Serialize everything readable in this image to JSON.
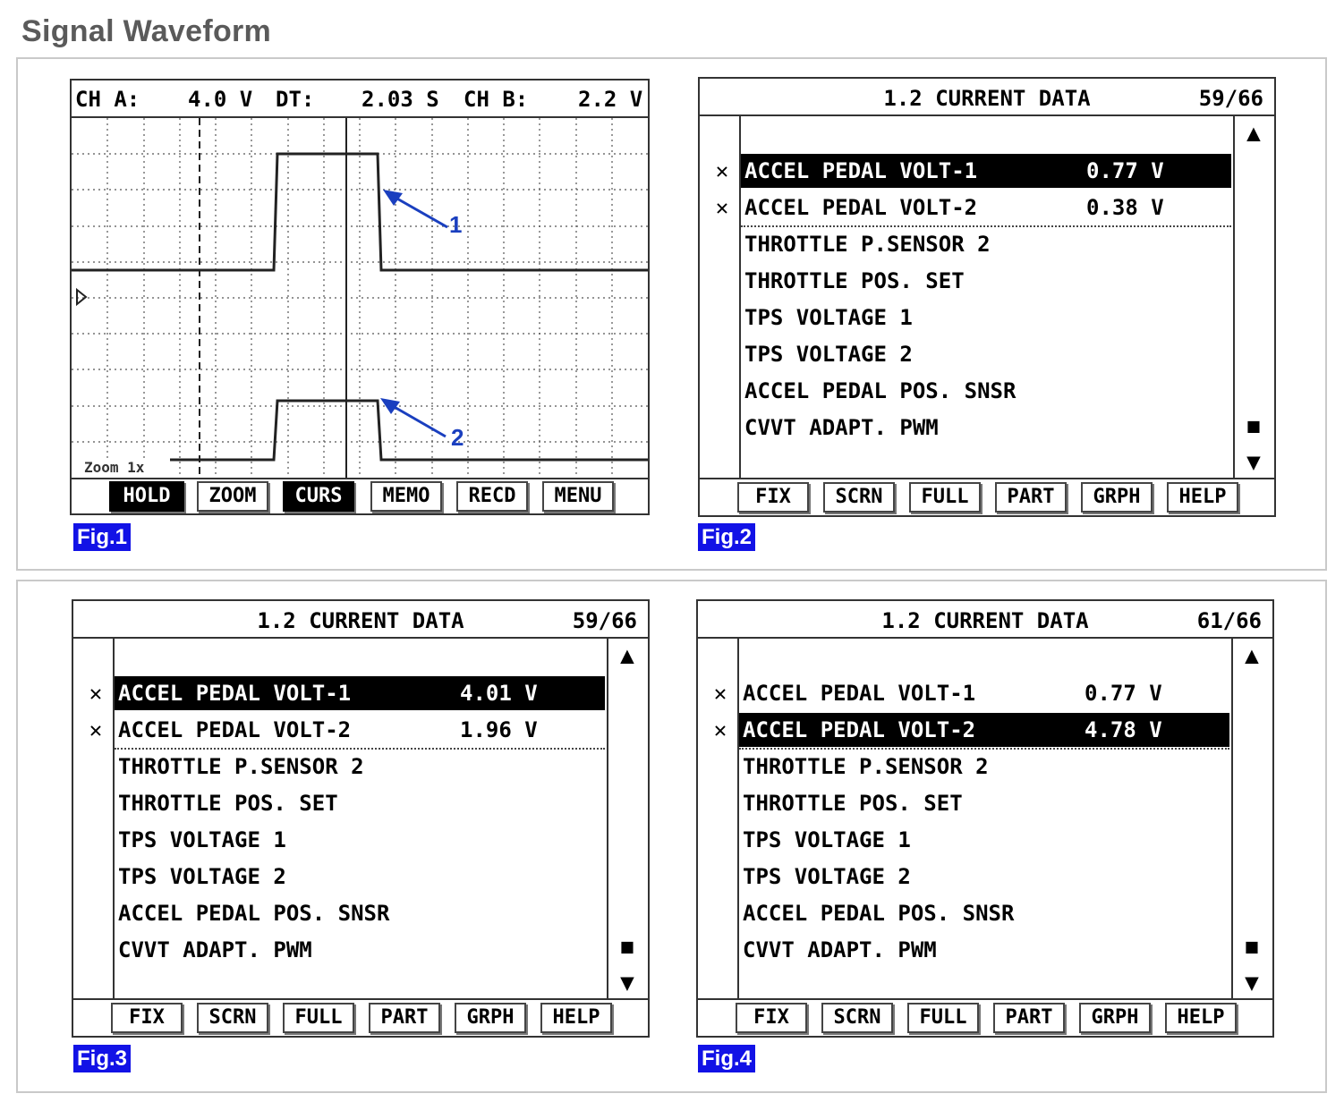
{
  "title": "Signal Waveform",
  "figures": {
    "fig1": "Fig.1",
    "fig2": "Fig.2",
    "fig3": "Fig.3",
    "fig4": "Fig.4"
  },
  "scope": {
    "ch_a_label": "CH A:",
    "ch_a_value": "4.0 V",
    "dt_label": "DT:",
    "dt_value": "2.03 S",
    "ch_b_label": "CH B:",
    "ch_b_value": "2.2 V",
    "zoom_label": "Zoom 1x",
    "callout_1": "1",
    "callout_2": "2",
    "softkeys": [
      "HOLD",
      "ZOOM",
      "CURS",
      "MEMO",
      "RECD",
      "MENU"
    ],
    "trace_color": "#222222",
    "arrow_color": "#1a3fbf"
  },
  "data_screens": [
    {
      "title": "1.2 CURRENT DATA",
      "page": "59/66",
      "selected_index": 0,
      "items": [
        {
          "name": "ACCEL PEDAL VOLT-1",
          "value": "0.77 V",
          "marked": true
        },
        {
          "name": "ACCEL PEDAL VOLT-2",
          "value": "0.38 V",
          "marked": true
        },
        {
          "name": "THROTTLE P.SENSOR 2",
          "value": "",
          "marked": false
        },
        {
          "name": "THROTTLE POS. SET",
          "value": "",
          "marked": false
        },
        {
          "name": "TPS VOLTAGE 1",
          "value": "",
          "marked": false
        },
        {
          "name": "TPS VOLTAGE 2",
          "value": "",
          "marked": false
        },
        {
          "name": "ACCEL PEDAL POS. SNSR",
          "value": "",
          "marked": false
        },
        {
          "name": "CVVT ADAPT. PWM",
          "value": "",
          "marked": false
        }
      ],
      "softkeys": [
        "FIX",
        "SCRN",
        "FULL",
        "PART",
        "GRPH",
        "HELP"
      ]
    },
    {
      "title": "1.2 CURRENT DATA",
      "page": "59/66",
      "selected_index": 0,
      "items": [
        {
          "name": "ACCEL PEDAL VOLT-1",
          "value": "4.01 V",
          "marked": true
        },
        {
          "name": "ACCEL PEDAL VOLT-2",
          "value": "1.96 V",
          "marked": true
        },
        {
          "name": "THROTTLE P.SENSOR 2",
          "value": "",
          "marked": false
        },
        {
          "name": "THROTTLE POS. SET",
          "value": "",
          "marked": false
        },
        {
          "name": "TPS VOLTAGE 1",
          "value": "",
          "marked": false
        },
        {
          "name": "TPS VOLTAGE 2",
          "value": "",
          "marked": false
        },
        {
          "name": "ACCEL PEDAL POS. SNSR",
          "value": "",
          "marked": false
        },
        {
          "name": "CVVT ADAPT. PWM",
          "value": "",
          "marked": false
        }
      ],
      "softkeys": [
        "FIX",
        "SCRN",
        "FULL",
        "PART",
        "GRPH",
        "HELP"
      ]
    },
    {
      "title": "1.2 CURRENT DATA",
      "page": "61/66",
      "selected_index": 1,
      "items": [
        {
          "name": "ACCEL PEDAL VOLT-1",
          "value": "0.77 V",
          "marked": true
        },
        {
          "name": "ACCEL PEDAL VOLT-2",
          "value": "4.78 V",
          "marked": true
        },
        {
          "name": "THROTTLE P.SENSOR 2",
          "value": "",
          "marked": false
        },
        {
          "name": "THROTTLE POS. SET",
          "value": "",
          "marked": false
        },
        {
          "name": "TPS VOLTAGE 1",
          "value": "",
          "marked": false
        },
        {
          "name": "TPS VOLTAGE 2",
          "value": "",
          "marked": false
        },
        {
          "name": "ACCEL PEDAL POS. SNSR",
          "value": "",
          "marked": false
        },
        {
          "name": "CVVT ADAPT. PWM",
          "value": "",
          "marked": false
        }
      ],
      "softkeys": [
        "FIX",
        "SCRN",
        "FULL",
        "PART",
        "GRPH",
        "HELP"
      ]
    }
  ],
  "icons": {
    "marker": "✕",
    "scroll_up": "▲",
    "scroll_down": "▼",
    "scroll_thumb": "■"
  }
}
